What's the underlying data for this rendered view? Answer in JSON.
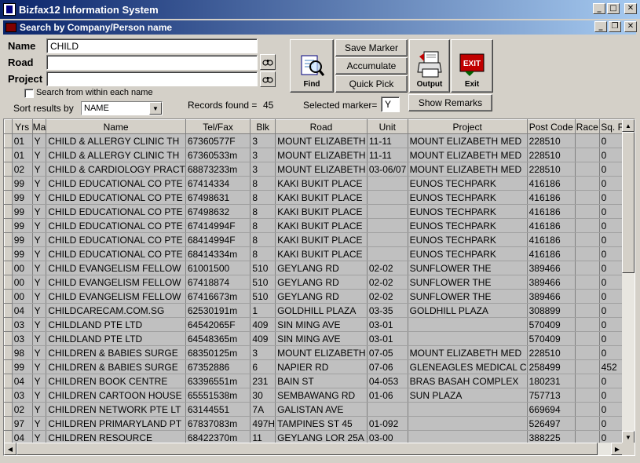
{
  "window": {
    "title": "Bizfax12 Information System"
  },
  "subwindow": {
    "title": "Search by Company/Person name"
  },
  "form": {
    "name_label": "Name",
    "name_value": "CHILD",
    "road_label": "Road",
    "road_value": "",
    "project_label": "Project",
    "project_value": "",
    "search_within_label": "Search from within each name",
    "sort_label": "Sort results by",
    "sort_value": "NAME",
    "records_found_label": "Records found =",
    "records_found_value": "45",
    "selected_marker_label": "Selected marker=",
    "selected_marker_value": "Y"
  },
  "buttons": {
    "find": "Find",
    "save_marker": "Save Marker",
    "accumulate": "Accumulate",
    "quick_pick": "Quick Pick",
    "output": "Output",
    "exit": "Exit",
    "exit_icon_text": "EXIT",
    "show_remarks": "Show Remarks"
  },
  "table": {
    "columns": [
      "Yrs",
      "Ma",
      "Name",
      "Tel/Fax",
      "Blk",
      "Road",
      "Unit",
      "Project",
      "Post Code",
      "Race",
      "Sq. Ft."
    ],
    "rows": [
      [
        "01",
        "Y",
        "CHILD & ALLERGY CLINIC TH",
        "67360577F",
        "3",
        "MOUNT ELIZABETH",
        "11-11",
        "MOUNT ELIZABETH MED",
        "228510",
        "",
        "0"
      ],
      [
        "01",
        "Y",
        "CHILD & ALLERGY CLINIC TH",
        "67360533m",
        "3",
        "MOUNT ELIZABETH",
        "11-11",
        "MOUNT ELIZABETH MED",
        "228510",
        "",
        "0"
      ],
      [
        "02",
        "Y",
        "CHILD & CARDIOLOGY PRACT",
        "68873233m",
        "3",
        "MOUNT ELIZABETH",
        "03-06/07",
        "MOUNT ELIZABETH MED",
        "228510",
        "",
        "0"
      ],
      [
        "99",
        "Y",
        "CHILD EDUCATIONAL CO PTE",
        "67414334",
        "8",
        "KAKI BUKIT PLACE",
        "",
        "EUNOS TECHPARK",
        "416186",
        "",
        "0"
      ],
      [
        "99",
        "Y",
        "CHILD EDUCATIONAL CO PTE",
        "67498631",
        "8",
        "KAKI BUKIT PLACE",
        "",
        "EUNOS TECHPARK",
        "416186",
        "",
        "0"
      ],
      [
        "99",
        "Y",
        "CHILD EDUCATIONAL CO PTE",
        "67498632",
        "8",
        "KAKI BUKIT PLACE",
        "",
        "EUNOS TECHPARK",
        "416186",
        "",
        "0"
      ],
      [
        "99",
        "Y",
        "CHILD EDUCATIONAL CO PTE",
        "67414994F",
        "8",
        "KAKI BUKIT PLACE",
        "",
        "EUNOS TECHPARK",
        "416186",
        "",
        "0"
      ],
      [
        "99",
        "Y",
        "CHILD EDUCATIONAL CO PTE",
        "68414994F",
        "8",
        "KAKI BUKIT PLACE",
        "",
        "EUNOS TECHPARK",
        "416186",
        "",
        "0"
      ],
      [
        "99",
        "Y",
        "CHILD EDUCATIONAL CO PTE",
        "68414334m",
        "8",
        "KAKI BUKIT PLACE",
        "",
        "EUNOS TECHPARK",
        "416186",
        "",
        "0"
      ],
      [
        "00",
        "Y",
        "CHILD EVANGELISM FELLOW",
        "61001500",
        "510",
        "GEYLANG RD",
        "02-02",
        "SUNFLOWER THE",
        "389466",
        "",
        "0"
      ],
      [
        "00",
        "Y",
        "CHILD EVANGELISM FELLOW",
        "67418874",
        "510",
        "GEYLANG RD",
        "02-02",
        "SUNFLOWER THE",
        "389466",
        "",
        "0"
      ],
      [
        "00",
        "Y",
        "CHILD EVANGELISM FELLOW",
        "67416673m",
        "510",
        "GEYLANG RD",
        "02-02",
        "SUNFLOWER THE",
        "389466",
        "",
        "0"
      ],
      [
        "04",
        "Y",
        "CHILDCARECAM.COM.SG",
        "62530191m",
        "1",
        "GOLDHILL PLAZA",
        "03-35",
        "GOLDHILL PLAZA",
        "308899",
        "",
        "0"
      ],
      [
        "03",
        "Y",
        "CHILDLAND PTE LTD",
        "64542065F",
        "409",
        "SIN MING AVE",
        "03-01",
        "",
        "570409",
        "",
        "0"
      ],
      [
        "03",
        "Y",
        "CHILDLAND PTE LTD",
        "64548365m",
        "409",
        "SIN MING AVE",
        "03-01",
        "",
        "570409",
        "",
        "0"
      ],
      [
        "98",
        "Y",
        "CHILDREN & BABIES SURGE",
        "68350125m",
        "3",
        "MOUNT ELIZABETH",
        "07-05",
        "MOUNT ELIZABETH MED",
        "228510",
        "",
        "0"
      ],
      [
        "99",
        "Y",
        "CHILDREN & BABIES SURGE",
        "67352886",
        "6",
        "NAPIER RD",
        "07-06",
        "GLENEAGLES MEDICAL C",
        "258499",
        "",
        "452"
      ],
      [
        "04",
        "Y",
        "CHILDREN BOOK CENTRE",
        "63396551m",
        "231",
        "BAIN ST",
        "04-053",
        "BRAS BASAH COMPLEX",
        "180231",
        "",
        "0"
      ],
      [
        "03",
        "Y",
        "CHILDREN CARTOON HOUSE",
        "65551538m",
        "30",
        "SEMBAWANG RD",
        "01-06",
        "SUN PLAZA",
        "757713",
        "",
        "0"
      ],
      [
        "02",
        "Y",
        "CHILDREN NETWORK PTE LT",
        "63144551",
        "7A",
        "GALISTAN AVE",
        "",
        "",
        "669694",
        "",
        "0"
      ],
      [
        "97",
        "Y",
        "CHILDREN PRIMARYLAND PT",
        "67837083m",
        "497H",
        "TAMPINES ST 45",
        "01-092",
        "",
        "526497",
        "",
        "0"
      ],
      [
        "04",
        "Y",
        "CHILDREN RESOURCE",
        "68422370m",
        "11",
        "GEYLANG LOR 25A",
        "03-00",
        "",
        "388225",
        "",
        "0"
      ]
    ]
  }
}
